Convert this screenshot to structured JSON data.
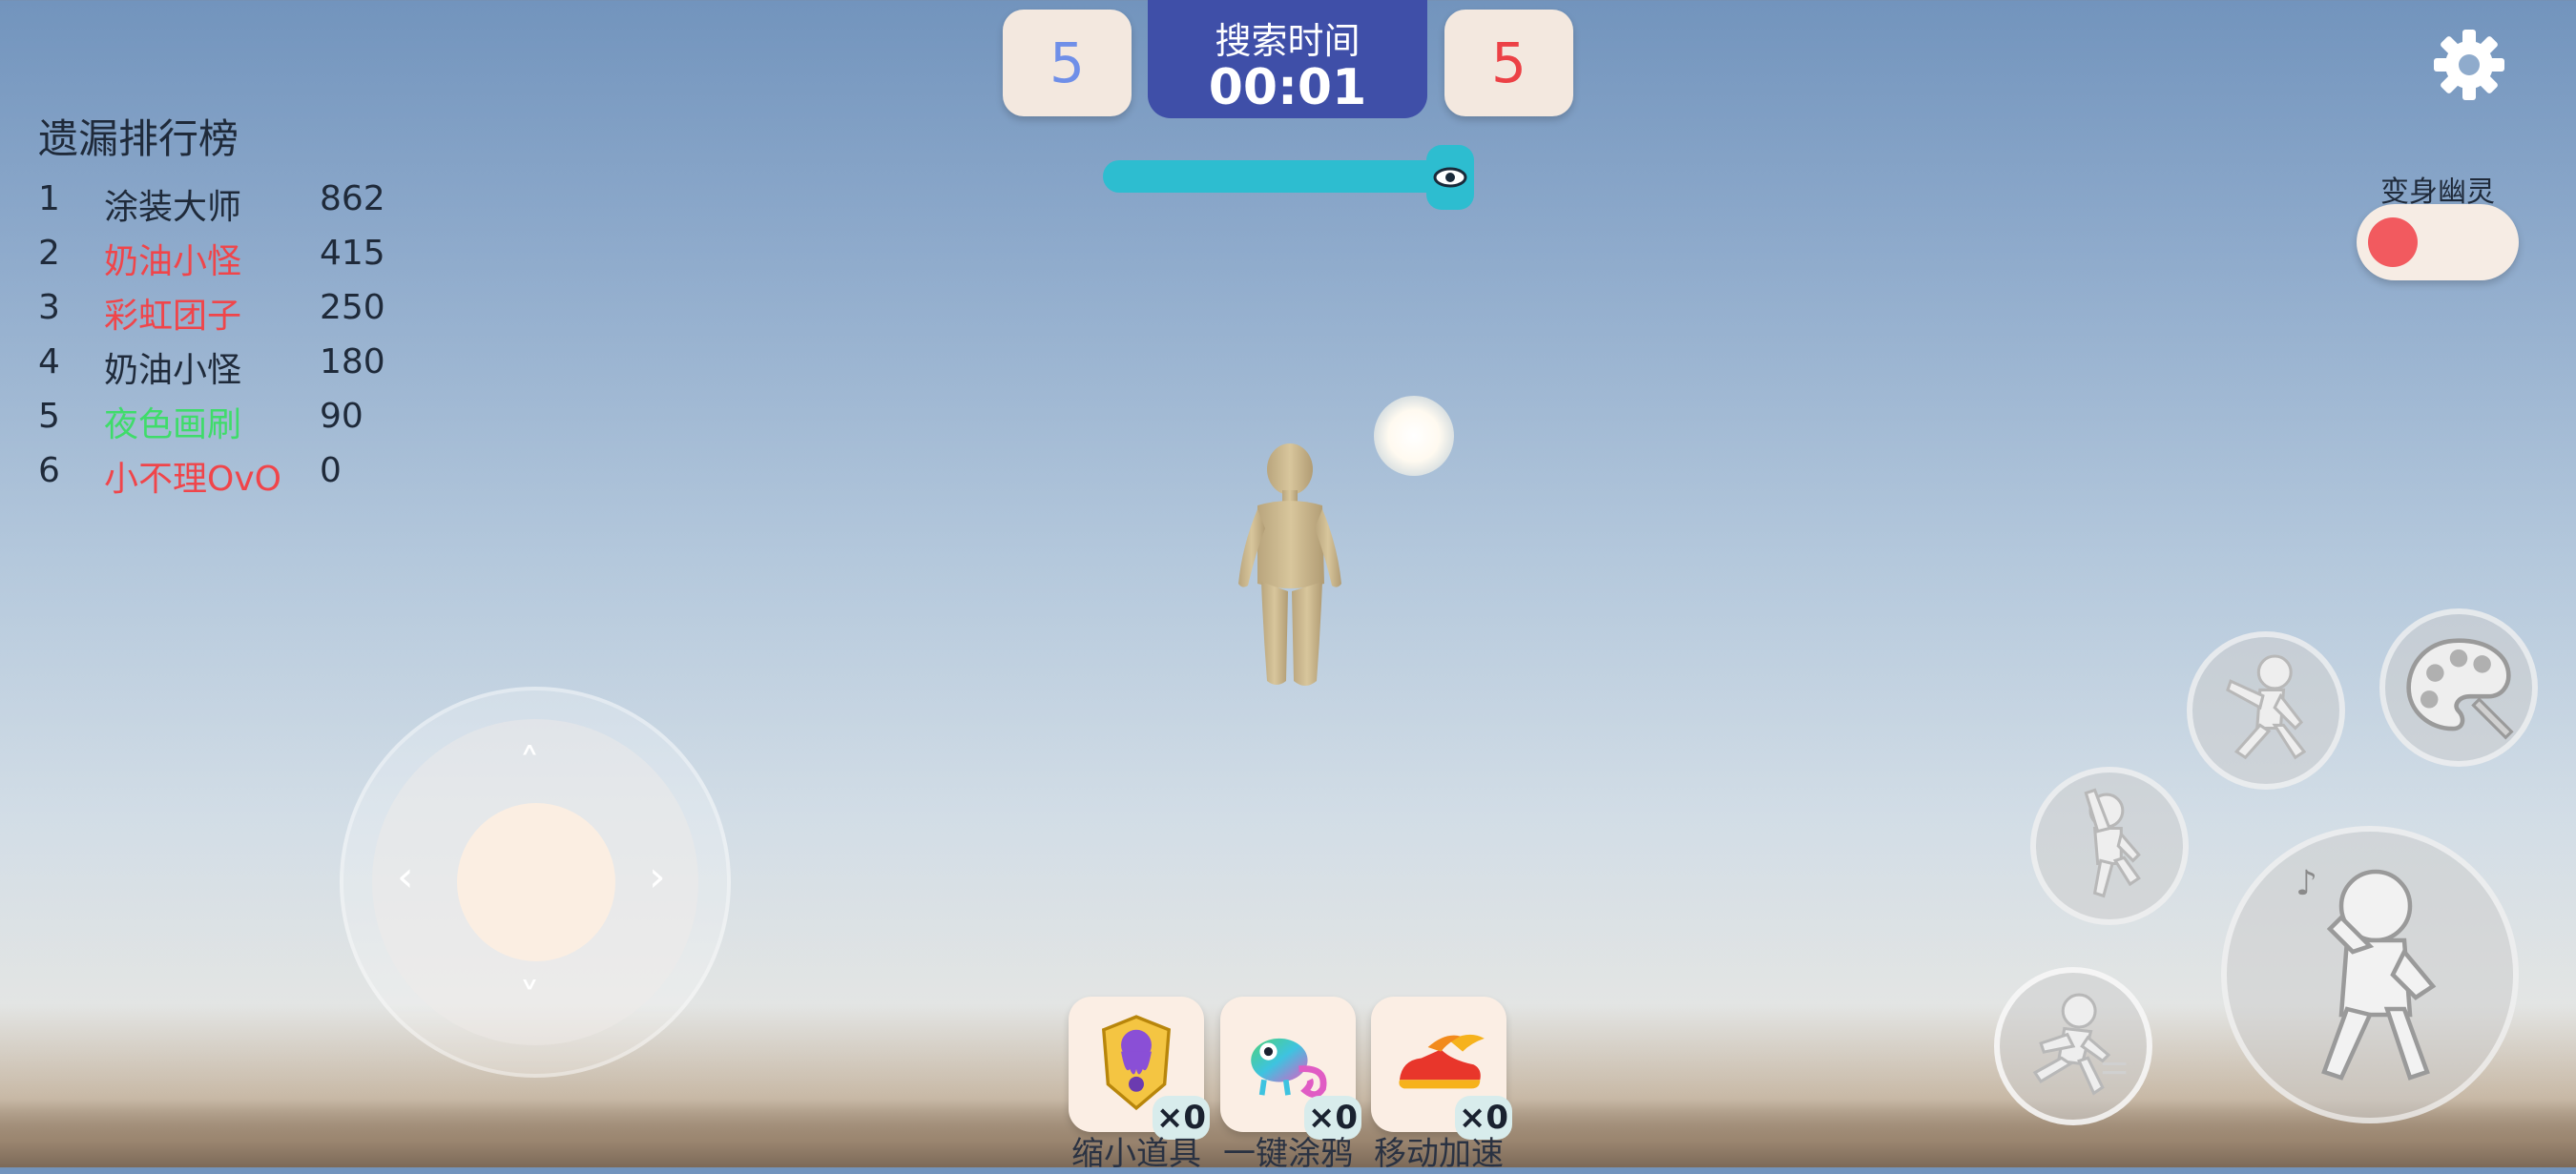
{
  "leaderboard": {
    "title": "遗漏排行榜",
    "rows": [
      {
        "rank": "1",
        "name": "涂装大师",
        "score": "862",
        "color": "#1f2a3a"
      },
      {
        "rank": "2",
        "name": "奶油小怪",
        "score": "415",
        "color": "#f0454a"
      },
      {
        "rank": "3",
        "name": "彩虹团子",
        "score": "250",
        "color": "#f0454a"
      },
      {
        "rank": "4",
        "name": "奶油小怪",
        "score": "180",
        "color": "#1f2a3a"
      },
      {
        "rank": "5",
        "name": "夜色画刷",
        "score": "90",
        "color": "#3fdc6a"
      },
      {
        "rank": "6",
        "name": "小不理OvO",
        "score": "0",
        "color": "#f0454a"
      }
    ]
  },
  "scoreboard": {
    "left_score": "5",
    "left_color": "#6f8fe8",
    "right_score": "5",
    "right_color": "#ec4146",
    "timer_label": "搜索时间",
    "timer_value": "00:01",
    "progress_color": "#2dbdd0"
  },
  "settings": {
    "icon": "gear-icon"
  },
  "ghost_toggle": {
    "label": "变身幽灵",
    "state": "off",
    "dot_color": "#f25a5f"
  },
  "joystick": {
    "arrows": {
      "up": "˄",
      "down": "˅",
      "left": "‹",
      "right": "›"
    }
  },
  "actions": [
    {
      "name": "emote-dance-button",
      "icon": "dance-pose-icon"
    },
    {
      "name": "paint-palette-button",
      "icon": "palette-icon"
    },
    {
      "name": "jump-button",
      "icon": "jump-pose-icon"
    },
    {
      "name": "sprint-button",
      "icon": "run-pose-icon"
    },
    {
      "name": "whistle-button",
      "icon": "whistle-pose-icon"
    }
  ],
  "items": [
    {
      "label": "缩小道具",
      "count": "×0",
      "icon": "shrink-octopus-icon"
    },
    {
      "label": "一键涂鸦",
      "count": "×0",
      "icon": "chameleon-icon"
    },
    {
      "label": "移动加速",
      "count": "×0",
      "icon": "speed-shoe-icon"
    }
  ]
}
